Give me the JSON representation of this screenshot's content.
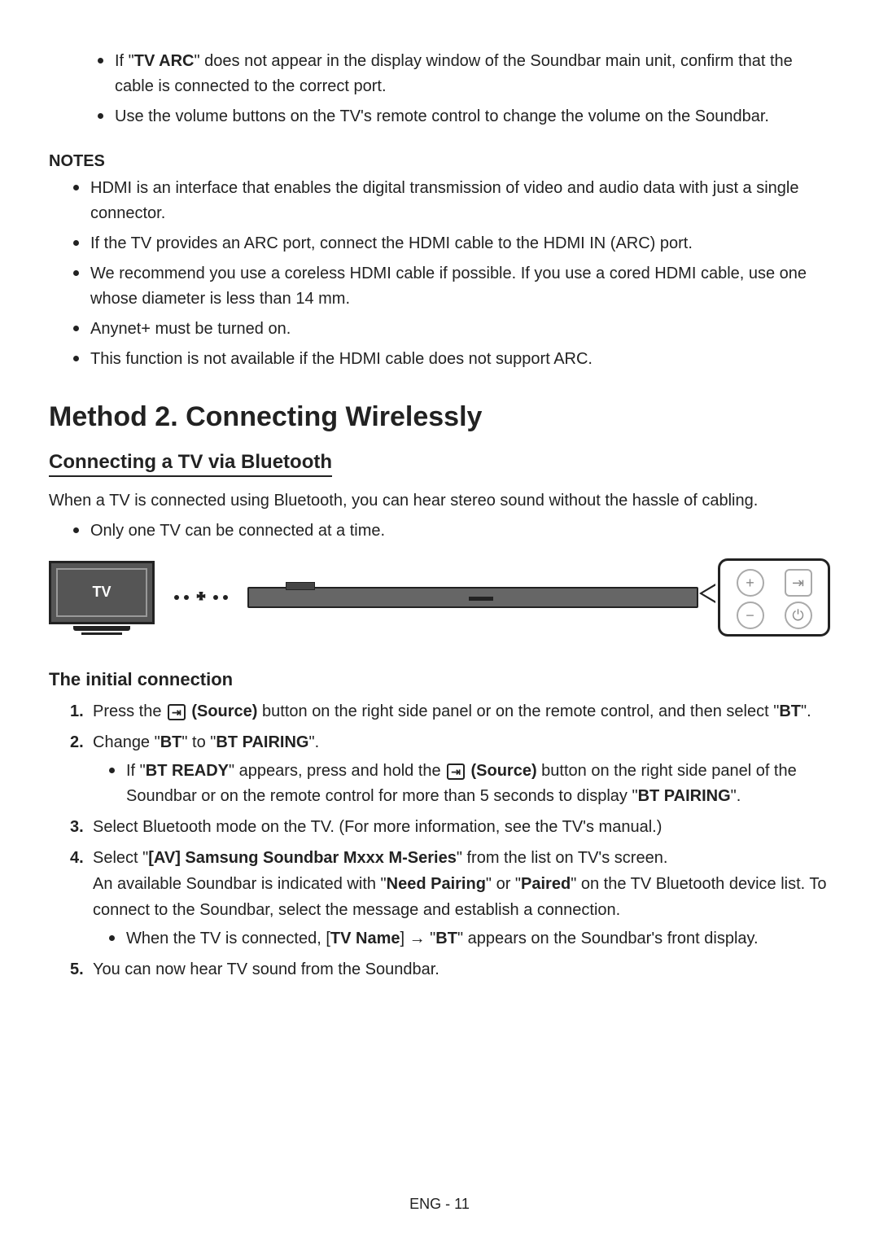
{
  "top_bullets": [
    {
      "pre": "If \"",
      "b1": "TV ARC",
      "post": "\" does not appear in the display window of the Soundbar main unit, confirm that the cable is connected to the correct port."
    },
    {
      "pre": "Use the volume buttons on the TV's remote control to change the volume on the Soundbar.",
      "b1": "",
      "post": ""
    }
  ],
  "notes_heading": "NOTES",
  "notes": [
    "HDMI is an interface that enables the digital transmission of video and audio data with just a single connector.",
    "If the TV provides an ARC port, connect the HDMI cable to the HDMI IN (ARC) port.",
    "We recommend you use a coreless HDMI cable if possible. If you use a cored HDMI cable, use one whose diameter is less than 14 mm.",
    "Anynet+ must be turned on.",
    "This function is not available if the HDMI cable does not support ARC."
  ],
  "section_title": "Method 2. Connecting Wirelessly",
  "sub_title": "Connecting a TV via Bluetooth",
  "intro": "When a TV is connected using Bluetooth, you can hear stereo sound without the hassle of cabling.",
  "intro_bullet": "Only one TV can be connected at a time.",
  "tv_label": "TV",
  "panel": {
    "plus": "+",
    "minus": "−",
    "source": "⇥",
    "power": "⏻"
  },
  "initial_title": "The initial connection",
  "steps": {
    "s1": {
      "pre": "Press the ",
      "icon": "⇥",
      "label": "(Source)",
      "mid": " button on the right side panel or on the remote control, and then select \"",
      "b1": "BT",
      "post": "\"."
    },
    "s2": {
      "pre": "Change \"",
      "b1": "BT",
      "mid": "\" to \"",
      "b2": "BT PAIRING",
      "post": "\"."
    },
    "s2_sub": {
      "pre": "If \"",
      "b1": "BT READY",
      "mid1": "\" appears, press and hold the ",
      "icon": "⇥",
      "label": "(Source)",
      "mid2": " button on the right side panel of the Soundbar or on the remote control for more than 5 seconds to display \"",
      "b2": "BT PAIRING",
      "post": "\"."
    },
    "s3": "Select Bluetooth mode on the TV. (For more information, see the TV's manual.)",
    "s4": {
      "pre": "Select \"",
      "b1": "[AV] Samsung Soundbar Mxxx M-Series",
      "mid1": "\" from the list on TV's screen.",
      "line2_pre": "An available Soundbar is indicated with \"",
      "b2": "Need Pairing",
      "mid2": "\" or \"",
      "b3": "Paired",
      "mid3": "\" on the TV Bluetooth device list. To connect to the Soundbar, select the message and establish a connection."
    },
    "s4_sub": {
      "pre": "When the TV is connected, [",
      "b1": "TV Name",
      "mid": "] → \"",
      "b2": "BT",
      "post": "\" appears on the Soundbar's front display."
    },
    "s5": "You can now hear TV sound from the Soundbar."
  },
  "footer": "ENG - 11"
}
